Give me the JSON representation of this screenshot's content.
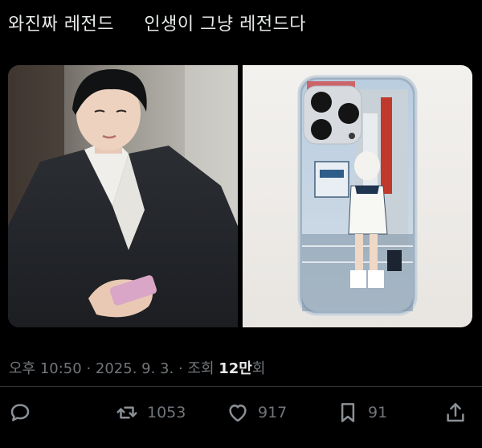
{
  "tweet": {
    "text": "와진짜 레전드     인생이 그냥 레전드다"
  },
  "media": [
    {
      "icon": "photo-man-in-suit-with-phone"
    },
    {
      "icon": "photo-phone-case-illustration"
    }
  ],
  "meta": {
    "time": "오후 10:50",
    "sep1": " · ",
    "date": "2025. 9. 3.",
    "sep2": " · ",
    "views_prefix": "조회 ",
    "views_count": "12만",
    "views_suffix": "회"
  },
  "actions": {
    "reply": {
      "icon": "reply-icon",
      "count": ""
    },
    "retweet": {
      "icon": "retweet-icon",
      "count": "1053"
    },
    "like": {
      "icon": "heart-icon",
      "count": "917"
    },
    "bookmark": {
      "icon": "bookmark-icon",
      "count": "91"
    },
    "share": {
      "icon": "share-icon",
      "count": ""
    }
  },
  "colors": {
    "background": "#000000",
    "text": "#e7e9ea",
    "muted": "#71767b"
  }
}
